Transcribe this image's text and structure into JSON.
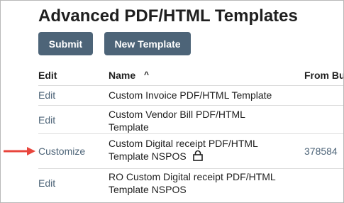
{
  "page": {
    "title": "Advanced PDF/HTML Templates"
  },
  "toolbar": {
    "submit_label": "Submit",
    "new_template_label": "New Template"
  },
  "table": {
    "columns": {
      "edit": "Edit",
      "name": "Name",
      "from": "From Bu"
    },
    "sort_icon": "^",
    "rows": [
      {
        "action": "Edit",
        "name_line1": "Custom Invoice PDF/HTML Template",
        "name_line2": "",
        "from": ""
      },
      {
        "action": "Edit",
        "name_line1": "Custom Vendor Bill PDF/HTML",
        "name_line2": "Template",
        "from": ""
      },
      {
        "action": "Customize",
        "name_line1": "Custom Digital receipt PDF/HTML",
        "name_line2": "Template NSPOS",
        "from": "378584",
        "locked": true
      },
      {
        "action": "Edit",
        "name_line1": "RO Custom Digital receipt PDF/HTML",
        "name_line2": "Template NSPOS",
        "from": ""
      }
    ]
  },
  "icons": {
    "lock": "lock-icon",
    "pointer_arrow": "red-arrow-icon",
    "sort": "sort-ascending-icon"
  },
  "colors": {
    "button_bg": "#4d6478",
    "link": "#4d6478",
    "arrow": "#e8453c"
  }
}
